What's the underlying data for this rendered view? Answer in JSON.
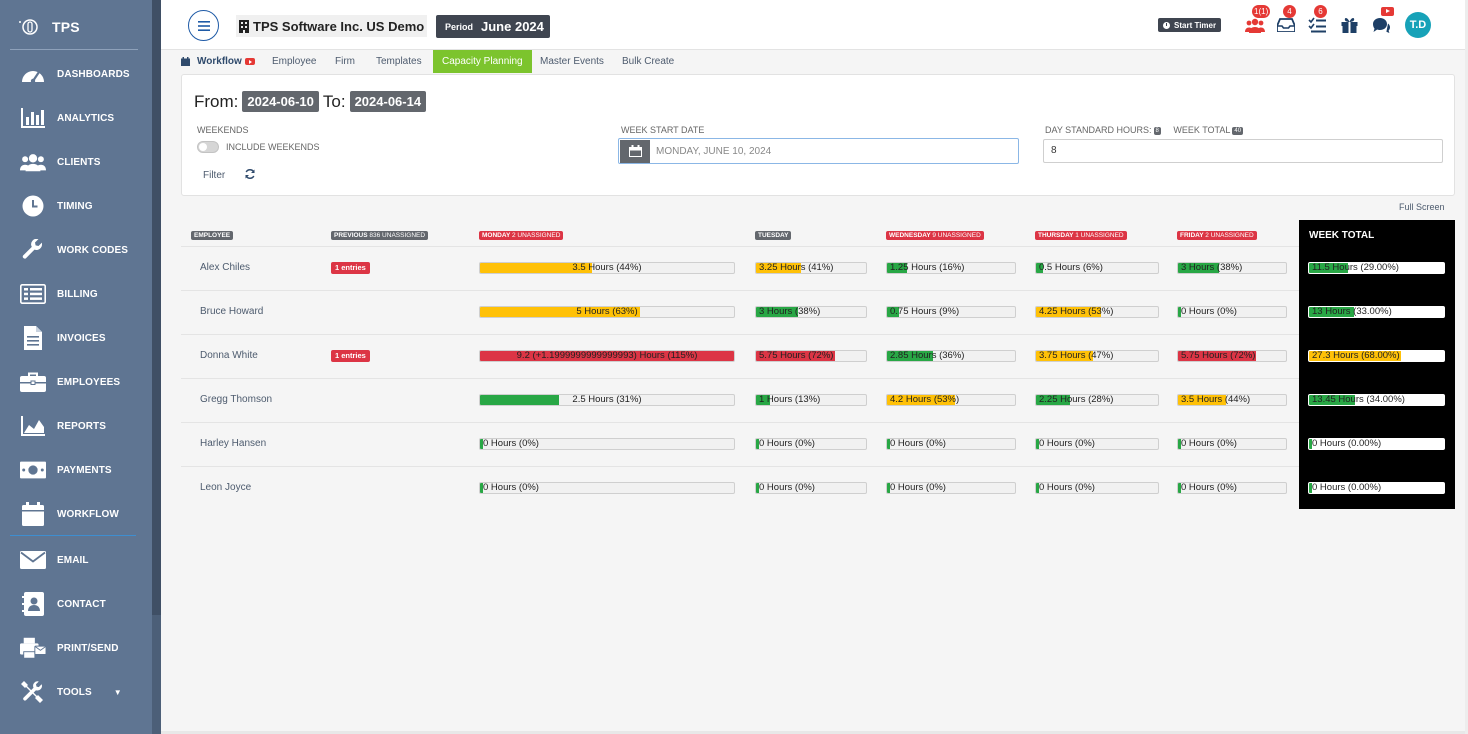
{
  "brand": {
    "name": "TPS"
  },
  "sidebar": {
    "items": [
      {
        "label": "DASHBOARDS",
        "icon": "gauge-icon"
      },
      {
        "label": "ANALYTICS",
        "icon": "bar-chart-icon"
      },
      {
        "label": "CLIENTS",
        "icon": "users-icon"
      },
      {
        "label": "TIMING",
        "icon": "clock-icon"
      },
      {
        "label": "WORK CODES",
        "icon": "wrench-icon"
      },
      {
        "label": "BILLING",
        "icon": "billing-list-icon"
      },
      {
        "label": "INVOICES",
        "icon": "invoice-file-icon"
      },
      {
        "label": "EMPLOYEES",
        "icon": "briefcase-icon"
      },
      {
        "label": "REPORTS",
        "icon": "area-chart-icon"
      },
      {
        "label": "PAYMENTS",
        "icon": "money-icon"
      },
      {
        "label": "WORKFLOW",
        "icon": "calendar-icon"
      },
      {
        "label": "EMAIL",
        "icon": "envelope-icon"
      },
      {
        "label": "CONTACT",
        "icon": "contact-card-icon"
      },
      {
        "label": "PRINT/SEND",
        "icon": "print-send-icon"
      },
      {
        "label": "TOOLS",
        "icon": "tools-icon"
      }
    ]
  },
  "topbar": {
    "company": "TPS Software Inc. US Demo",
    "period_label": "Period",
    "period_value": "June 2024",
    "start_timer": "Start Timer",
    "badges": {
      "team": "1(1)",
      "inbox": "4",
      "tasks": "6"
    },
    "avatar": "T.D"
  },
  "tabs": [
    "Workflow",
    "Employee",
    "Firm",
    "Templates",
    "Capacity Planning",
    "Master Events",
    "Bulk Create"
  ],
  "filters": {
    "from_label": "From:",
    "from": "2024-06-10",
    "to_label": "To:",
    "to": "2024-06-14",
    "weekends_label": "WEEKENDS",
    "include_weekends": "INCLUDE WEEKENDS",
    "week_start_label": "WEEK START DATE",
    "week_start_value": "MONDAY, JUNE 10, 2024",
    "day_std_label": "DAY STANDARD HOURS:",
    "day_std_badge": "8",
    "week_total_label": "WEEK TOTAL",
    "week_total_badge": "40",
    "hours_value": "8",
    "filter": "Filter"
  },
  "full_screen": "Full Screen",
  "table": {
    "headers": {
      "employee": "EMPLOYEE",
      "previous": "PREVIOUS",
      "previous_sub": "836 UNASSIGNED",
      "monday": "MONDAY",
      "monday_sub": "2 UNASSIGNED",
      "tuesday": "TUESDAY",
      "wednesday": "WEDNESDAY",
      "wednesday_sub": "9 UNASSIGNED",
      "thursday": "THURSDAY",
      "thursday_sub": "1 UNASSIGNED",
      "friday": "FRIDAY",
      "friday_sub": "2 UNASSIGNED",
      "week_total": "WEEK TOTAL"
    },
    "rows": [
      {
        "name": "Alex Chiles",
        "entries": "1 entries",
        "days": [
          {
            "text": "3.5 Hours (44%)",
            "pct": 44,
            "color": "#ffc107"
          },
          {
            "text": "3.25 Hours (41%)",
            "pct": 41,
            "color": "#ffc107"
          },
          {
            "text": "1.25 Hours (16%)",
            "pct": 16,
            "color": "#28a745"
          },
          {
            "text": "0.5 Hours (6%)",
            "pct": 6,
            "color": "#28a745"
          },
          {
            "text": "3 Hours (38%)",
            "pct": 38,
            "color": "#28a745"
          }
        ],
        "week": {
          "text": "11.5 Hours (29.00%)",
          "pct": 29,
          "color": "#28a745"
        }
      },
      {
        "name": "Bruce Howard",
        "entries": "",
        "days": [
          {
            "text": "5 Hours (63%)",
            "pct": 63,
            "color": "#ffc107"
          },
          {
            "text": "3 Hours (38%)",
            "pct": 38,
            "color": "#28a745"
          },
          {
            "text": "0.75 Hours (9%)",
            "pct": 9,
            "color": "#28a745"
          },
          {
            "text": "4.25 Hours (53%)",
            "pct": 53,
            "color": "#ffc107"
          },
          {
            "text": "0 Hours (0%)",
            "pct": 0,
            "color": "#28a745"
          }
        ],
        "week": {
          "text": "13 Hours (33.00%)",
          "pct": 33,
          "color": "#28a745"
        }
      },
      {
        "name": "Donna White",
        "entries": "1 entries",
        "days": [
          {
            "text": "9.2 (+1.1999999999999993) Hours (115%)",
            "pct": 100,
            "color": "#dc3545"
          },
          {
            "text": "5.75 Hours (72%)",
            "pct": 72,
            "color": "#dc3545"
          },
          {
            "text": "2.85 Hours (36%)",
            "pct": 36,
            "color": "#28a745"
          },
          {
            "text": "3.75 Hours (47%)",
            "pct": 47,
            "color": "#ffc107"
          },
          {
            "text": "5.75 Hours (72%)",
            "pct": 72,
            "color": "#dc3545"
          }
        ],
        "week": {
          "text": "27.3 Hours (68.00%)",
          "pct": 68,
          "color": "#ffc107"
        }
      },
      {
        "name": "Gregg Thomson",
        "entries": "",
        "days": [
          {
            "text": "2.5 Hours (31%)",
            "pct": 31,
            "color": "#28a745"
          },
          {
            "text": "1 Hours (13%)",
            "pct": 13,
            "color": "#28a745"
          },
          {
            "text": "4.2 Hours (53%)",
            "pct": 53,
            "color": "#ffc107"
          },
          {
            "text": "2.25 Hours (28%)",
            "pct": 28,
            "color": "#28a745"
          },
          {
            "text": "3.5 Hours (44%)",
            "pct": 44,
            "color": "#ffc107"
          }
        ],
        "week": {
          "text": "13.45 Hours (34.00%)",
          "pct": 34,
          "color": "#28a745"
        }
      },
      {
        "name": "Harley Hansen",
        "entries": "",
        "days": [
          {
            "text": "0 Hours (0%)",
            "pct": 0,
            "color": "#28a745"
          },
          {
            "text": "0 Hours (0%)",
            "pct": 0,
            "color": "#28a745"
          },
          {
            "text": "0 Hours (0%)",
            "pct": 0,
            "color": "#28a745"
          },
          {
            "text": "0 Hours (0%)",
            "pct": 0,
            "color": "#28a745"
          },
          {
            "text": "0 Hours (0%)",
            "pct": 0,
            "color": "#28a745"
          }
        ],
        "week": {
          "text": "0 Hours (0.00%)",
          "pct": 0,
          "color": "#28a745"
        }
      },
      {
        "name": "Leon Joyce",
        "entries": "",
        "days": [
          {
            "text": "0 Hours (0%)",
            "pct": 0,
            "color": "#28a745"
          },
          {
            "text": "0 Hours (0%)",
            "pct": 0,
            "color": "#28a745"
          },
          {
            "text": "0 Hours (0%)",
            "pct": 0,
            "color": "#28a745"
          },
          {
            "text": "0 Hours (0%)",
            "pct": 0,
            "color": "#28a745"
          },
          {
            "text": "0 Hours (0%)",
            "pct": 0,
            "color": "#28a745"
          }
        ],
        "week": {
          "text": "0 Hours (0.00%)",
          "pct": 0,
          "color": "#28a745"
        }
      }
    ]
  }
}
